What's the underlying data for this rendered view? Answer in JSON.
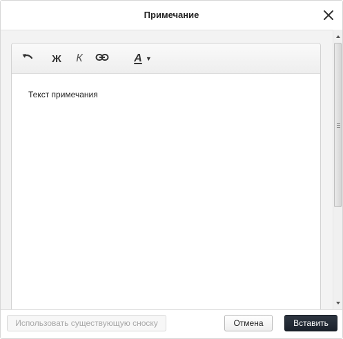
{
  "dialog": {
    "title": "Примечание"
  },
  "toolbar": {
    "undo_icon": "undo-icon",
    "bold_label": "Ж",
    "italic_label": "К",
    "link_icon": "link-icon",
    "text_color_label": "A",
    "dropdown_arrow": "▼"
  },
  "editor": {
    "content": "Текст примечания"
  },
  "footer": {
    "use_existing_label": "Использовать существующую сноску",
    "cancel_label": "Отмена",
    "insert_label": "Вставить"
  },
  "colors": {
    "primary_button": "#1f2630",
    "disabled_text": "#a8a8a8"
  }
}
